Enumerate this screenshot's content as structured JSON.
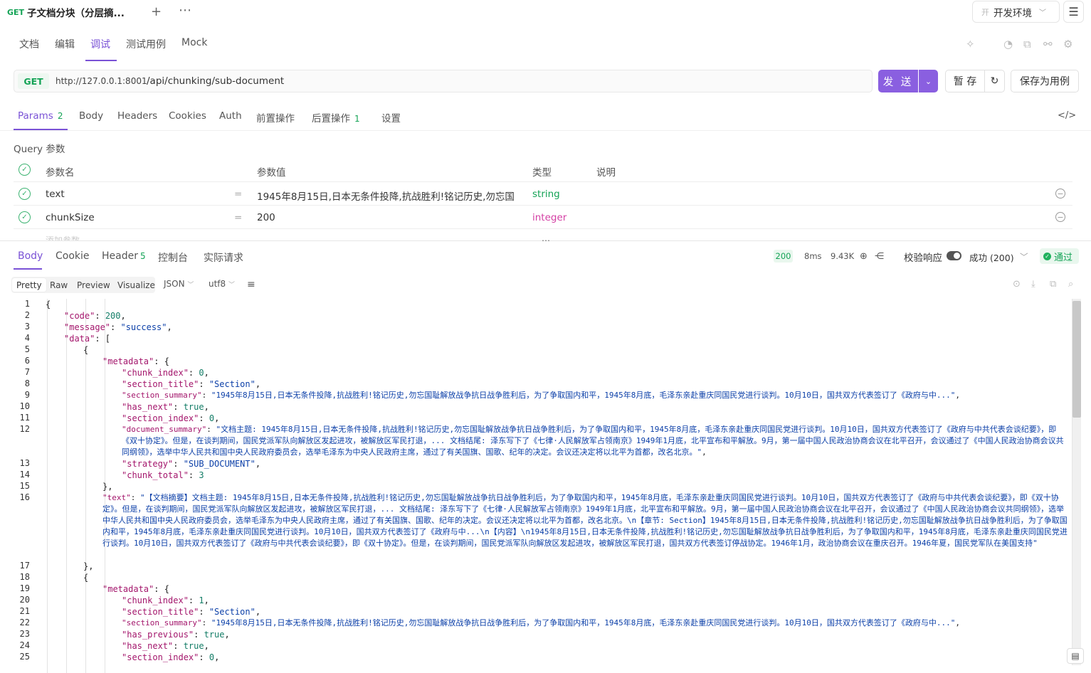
{
  "request_tab": {
    "method": "GET",
    "name": "子文档分块（分层摘..."
  },
  "environment": {
    "prefix": "开",
    "name": "开发环境"
  },
  "mode_tabs": [
    "文档",
    "编辑",
    "调试",
    "测试用例",
    "Mock"
  ],
  "url": {
    "method": "GET",
    "host": "http://127.0.0.1:8001",
    "path": "/api/chunking/sub-document"
  },
  "actions": {
    "send": "发 送",
    "save_draft": "暂 存",
    "save_case": "保存为用例"
  },
  "request_tabs": {
    "params": "Params",
    "params_count": "2",
    "body": "Body",
    "headers": "Headers",
    "cookies": "Cookies",
    "auth": "Auth",
    "pre": "前置操作",
    "post": "后置操作",
    "post_count": "1",
    "settings": "设置"
  },
  "query": {
    "label": "Query 参数",
    "columns": [
      "参数名",
      "参数值",
      "类型",
      "说明"
    ],
    "rows": [
      {
        "name": "text",
        "eq": "=",
        "value": "1945年8月15日,日本无条件投降,抗战胜利!铭记历史,勿忘国",
        "type": "string"
      },
      {
        "name": "chunkSize",
        "eq": "=",
        "value": "200",
        "type": "integer"
      }
    ],
    "add_placeholder": "添加参数"
  },
  "response_tabs": {
    "body": "Body",
    "cookie": "Cookie",
    "header": "Header",
    "header_count": "5",
    "console": "控制台",
    "actual": "实际请求"
  },
  "response_meta": {
    "status": "200",
    "time": "8ms",
    "size": "9.43K",
    "validate": "校验响应",
    "result": "成功 (200)",
    "pass": "通过"
  },
  "format_tabs": [
    "Pretty",
    "Raw",
    "Preview",
    "Visualize"
  ],
  "format_type": "JSON",
  "encoding": "utf8",
  "colors": {
    "accent": "#7a52d6",
    "success": "#14a356",
    "string": "#0b3fa8",
    "key": "#a3156b"
  },
  "code_lines": {
    "l1": "{",
    "l2_k": "\"code\"",
    "l2_v": "200",
    "l3_k": "\"message\"",
    "l3_v": "\"success\"",
    "l4_k": "\"data\"",
    "l5": "{",
    "l6_k": "\"metadata\"",
    "l7_k": "\"chunk_index\"",
    "l7_v": "0",
    "l8_k": "\"section_title\"",
    "l8_v": "\"Section\"",
    "l9_k": "\"section_summary\"",
    "l9_v": "\"1945年8月15日,日本无条件投降,抗战胜利!铭记历史,勿忘国耻解放战争抗日战争胜利后，为了争取国内和平，1945年8月底，毛泽东亲赴重庆同国民党进行谈判。10月10日，国共双方代表签订了《政府与中...\"",
    "l10_k": "\"has_next\"",
    "l10_v": "true",
    "l11_k": "\"section_index\"",
    "l11_v": "0",
    "l12_k": "\"document_summary\"",
    "l12_v": "\"文档主题: 1945年8月15日,日本无条件投降,抗战胜利!铭记历史,勿忘国耻解放战争抗日战争胜利后，为了争取国内和平，1945年8月底，毛泽东亲赴重庆同国民党进行谈判。10月10日，国共双方代表签订了《政府与中共代表会谈纪要》，即《双十协定》。但是，在谈判期间，国民党派军队向解放区发起进攻，被解放区军民打退，... 文档结尾: 泽东写下了《七律·人民解放军占领南京》1949年1月底，北平宣布和平解放。9月，第一届中国人民政治协商会议在北平召开，会议通过了《中国人民政治协商会议共同纲领》，选举中华人民共和国中央人民政府委员会，选举毛泽东为中央人民政府主席，通过了有关国旗、国歌、纪年的决定。会议还决定将以北平为首都，改名北京。\"",
    "l13_k": "\"strategy\"",
    "l13_v": "\"SUB_DOCUMENT\"",
    "l14_k": "\"chunk_total\"",
    "l14_v": "3",
    "l15": "},",
    "l16_k": "\"text\"",
    "l16_v": "\"【文档摘要】文档主题: 1945年8月15日,日本无条件投降,抗战胜利!铭记历史,勿忘国耻解放战争抗日战争胜利后，为了争取国内和平，1945年8月底，毛泽东亲赴重庆同国民党进行谈判。10月10日，国共双方代表签订了《政府与中共代表会谈纪要》，即《双十协定》。但是，在谈判期间，国民党派军队向解放区发起进攻，被解放区军民打退，... 文档结尾: 泽东写下了《七律·人民解放军占领南京》1949年1月底，北平宣布和平解放。9月，第一届中国人民政治协商会议在北平召开，会议通过了《中国人民政治协商会议共同纲领》，选举中华人民共和国中央人民政府委员会，选举毛泽东为中央人民政府主席，通过了有关国旗、国歌、纪年的决定。会议还决定将以北平为首都，改名北京。\\n【章节: Section】1945年8月15日,日本无条件投降,抗战胜利!铭记历史,勿忘国耻解放战争抗日战争胜利后，为了争取国内和平，1945年8月底，毛泽东亲赴重庆同国民党进行谈判。10月10日，国共双方代表签订了《政府与中...\\n【内容】\\n1945年8月15日,日本无条件投降,抗战胜利!铭记历史,勿忘国耻解放战争抗日战争胜利后，为了争取国内和平，1945年8月底，毛泽东亲赴重庆同国民党进行谈判。10月10日，国共双方代表签订了《政府与中共代表会谈纪要》，即《双十协定》。但是，在谈判期间，国民党派军队向解放区发起进攻，被解放区军民打退，国共双方代表签订停战协定。1946年1月，政治协商会议在重庆召开。1946年夏，国民党军队在美国支持\"",
    "l17": "},",
    "l18": "{",
    "l19_k": "\"metadata\"",
    "l20_k": "\"chunk_index\"",
    "l20_v": "1",
    "l21_k": "\"section_title\"",
    "l21_v": "\"Section\"",
    "l22_k": "\"section_summary\"",
    "l22_v": "\"1945年8月15日,日本无条件投降,抗战胜利!铭记历史,勿忘国耻解放战争抗日战争胜利后，为了争取国内和平，1945年8月底，毛泽东亲赴重庆同国民党进行谈判。10月10日，国共双方代表签订了《政府与中...\"",
    "l23_k": "\"has_previous\"",
    "l23_v": "true",
    "l24_k": "\"has_next\"",
    "l24_v": "true",
    "l25_k": "\"section_index\"",
    "l25_v": "0"
  }
}
